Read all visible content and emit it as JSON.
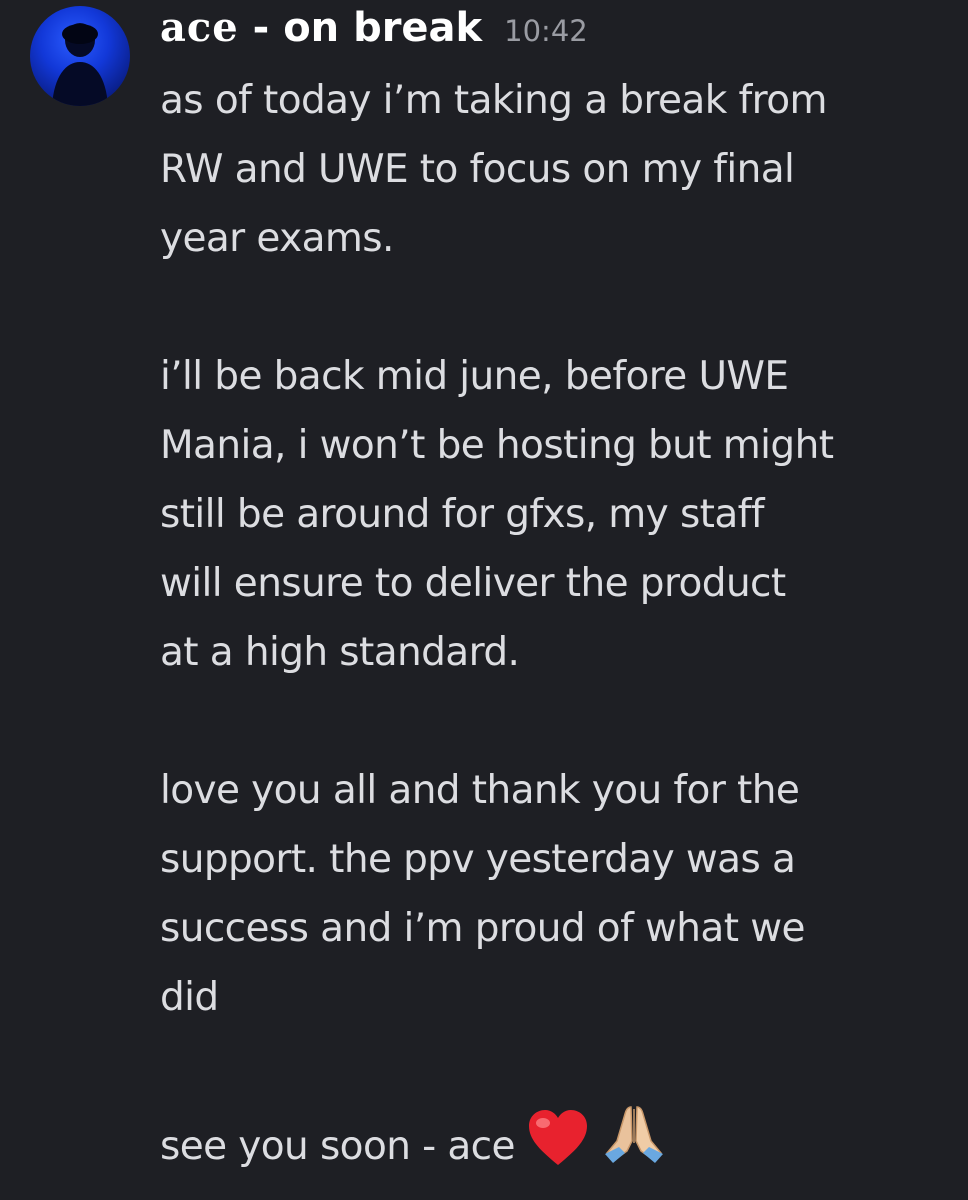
{
  "message": {
    "author": {
      "stylized_name": "ace",
      "name_suffix": " - on break"
    },
    "timestamp": "10:42",
    "paragraphs": [
      [
        "as of today i’m taking a break from",
        "RW and UWE to focus on my final",
        "year exams."
      ],
      [
        "i’ll be back mid june, before UWE",
        "Mania, i won’t be hosting but might",
        "still be around for gfxs, my staff",
        "will ensure to deliver the product",
        "at a high standard."
      ],
      [
        "love you all and thank you for the",
        "support. the ppv yesterday was a",
        "success and i’m proud of what we",
        "did"
      ],
      [
        "see you soon - ace"
      ]
    ],
    "emojis": [
      "red-heart",
      "folded-hands"
    ]
  },
  "colors": {
    "background": "#1e1f24",
    "username": "#ffffff",
    "timestamp": "#9a9ca3",
    "text": "#dcdde1"
  }
}
